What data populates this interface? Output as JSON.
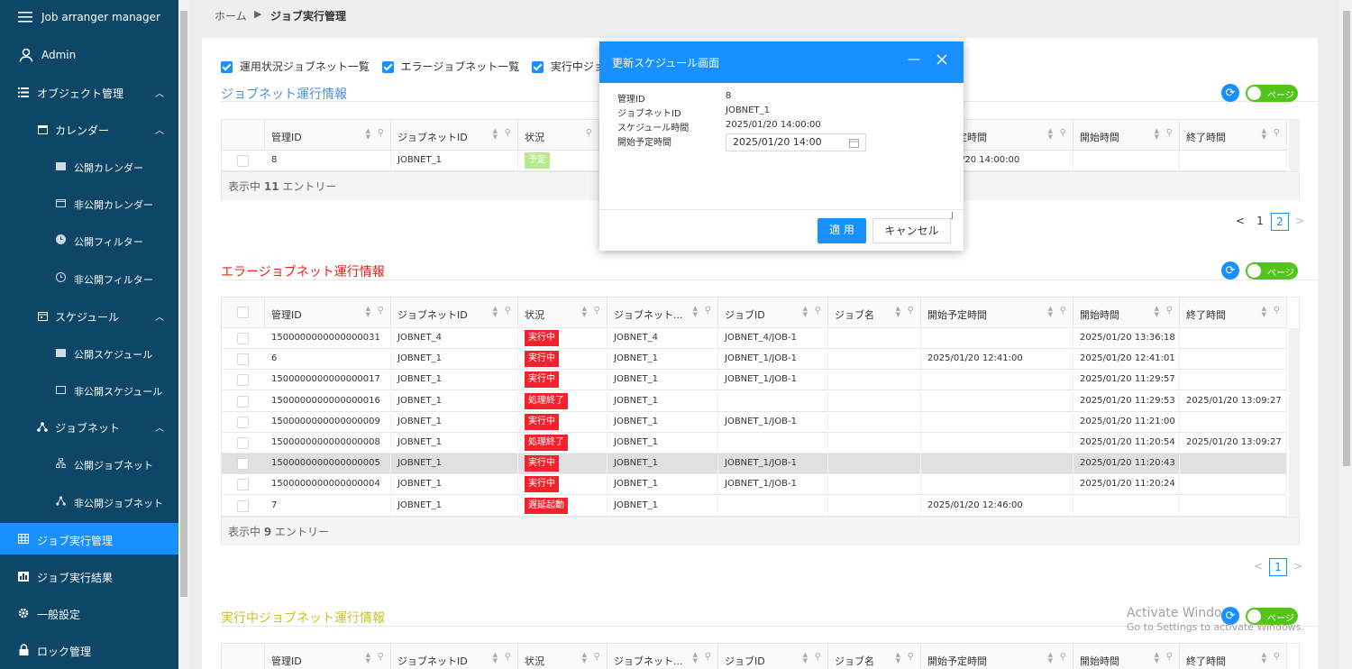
{
  "sidebar": {
    "app_title": "Job arranger manager",
    "user": "Admin",
    "items": [
      {
        "label": "オブジェクト管理",
        "chevron": "^"
      },
      {
        "label": "カレンダー",
        "chevron": "^"
      },
      {
        "label": "公開カレンダー"
      },
      {
        "label": "非公開カレンダー"
      },
      {
        "label": "公開フィルター"
      },
      {
        "label": "非公開フィルター"
      },
      {
        "label": "スケジュール",
        "chevron": "^"
      },
      {
        "label": "公開スケジュール"
      },
      {
        "label": "非公開スケジュール"
      },
      {
        "label": "ジョブネット",
        "chevron": "^"
      },
      {
        "label": "公開ジョブネット"
      },
      {
        "label": "非公開ジョブネット"
      },
      {
        "label": "ジョブ実行管理"
      },
      {
        "label": "ジョブ実行結果"
      },
      {
        "label": "一般設定"
      },
      {
        "label": "ロック管理"
      }
    ]
  },
  "breadcrumb": {
    "home": "ホーム",
    "sep": "▶",
    "current": "ジョブ実行管理"
  },
  "filters": [
    {
      "label": "運用状況ジョブネット一覧",
      "checked": true
    },
    {
      "label": "エラージョブネット一覧",
      "checked": true
    },
    {
      "label": "実行中ジョ",
      "checked": true
    }
  ],
  "colors": {
    "accent": "#1890ff",
    "sidebar": "#0d4667",
    "error": "#f5222d",
    "title_blue": "#4a90d9",
    "title_red": "#e0251b",
    "title_yellow": "#c5c22b"
  },
  "switch_label": "ページ",
  "section1": {
    "title": "ジョブネット運行情報",
    "headers": [
      "管理ID",
      "ジョブネットID",
      "状況",
      "定時間",
      "開始時間",
      "終了時間"
    ],
    "rows": [
      {
        "id": "8",
        "jobnet": "JOBNET_1",
        "status": "予定",
        "sched": "/20 14:00:00",
        "start": "",
        "end": ""
      }
    ],
    "footer_prefix": "表示中",
    "footer_count": "11",
    "footer_suffix": "エントリー",
    "pages": [
      "1",
      "2"
    ],
    "current_page": "2"
  },
  "section2": {
    "title": "エラージョブネット運行情報",
    "headers": [
      "管理ID",
      "ジョブネットID",
      "状況",
      "ジョブネット...",
      "ジョブID",
      "ジョブ名",
      "開始予定時間",
      "開始時間",
      "終了時間"
    ],
    "rows": [
      {
        "id": "1500000000000000031",
        "jobnet": "JOBNET_4",
        "status": "実行中",
        "jobnet2": "JOBNET_4",
        "jobid": "JOBNET_4/JOB-1",
        "jobname": "",
        "sched": "",
        "start": "2025/01/20 13:36:18",
        "end": ""
      },
      {
        "id": "6",
        "jobnet": "JOBNET_1",
        "status": "実行中",
        "jobnet2": "JOBNET_1",
        "jobid": "JOBNET_1/JOB-1",
        "jobname": "",
        "sched": "2025/01/20 12:41:00",
        "start": "2025/01/20 12:41:01",
        "end": ""
      },
      {
        "id": "1500000000000000017",
        "jobnet": "JOBNET_1",
        "status": "実行中",
        "jobnet2": "JOBNET_1",
        "jobid": "JOBNET_1/JOB-1",
        "jobname": "",
        "sched": "",
        "start": "2025/01/20 11:29:57",
        "end": ""
      },
      {
        "id": "1500000000000000016",
        "jobnet": "JOBNET_1",
        "status": "処理終了",
        "jobnet2": "JOBNET_1",
        "jobid": "",
        "jobname": "",
        "sched": "",
        "start": "2025/01/20 11:29:53",
        "end": "2025/01/20 13:09:27"
      },
      {
        "id": "1500000000000000009",
        "jobnet": "JOBNET_1",
        "status": "実行中",
        "jobnet2": "JOBNET_1",
        "jobid": "JOBNET_1/JOB-1",
        "jobname": "",
        "sched": "",
        "start": "2025/01/20 11:21:00",
        "end": ""
      },
      {
        "id": "1500000000000000008",
        "jobnet": "JOBNET_1",
        "status": "処理終了",
        "jobnet2": "JOBNET_1",
        "jobid": "",
        "jobname": "",
        "sched": "",
        "start": "2025/01/20 11:20:54",
        "end": "2025/01/20 13:09:27"
      },
      {
        "id": "1500000000000000005",
        "jobnet": "JOBNET_1",
        "status": "実行中",
        "jobnet2": "JOBNET_1",
        "jobid": "JOBNET_1/JOB-1",
        "jobname": "",
        "sched": "",
        "start": "2025/01/20 11:20:43",
        "end": "",
        "selected": true
      },
      {
        "id": "1500000000000000004",
        "jobnet": "JOBNET_1",
        "status": "実行中",
        "jobnet2": "JOBNET_1",
        "jobid": "JOBNET_1/JOB-1",
        "jobname": "",
        "sched": "",
        "start": "2025/01/20 11:20:24",
        "end": ""
      },
      {
        "id": "7",
        "jobnet": "JOBNET_1",
        "status": "遅延起動",
        "jobnet2": "JOBNET_1",
        "jobid": "",
        "jobname": "",
        "sched": "2025/01/20 12:46:00",
        "start": "",
        "end": ""
      }
    ],
    "footer_prefix": "表示中",
    "footer_count": "9",
    "footer_suffix": "エントリー",
    "pages": [
      "1"
    ],
    "current_page": "1"
  },
  "section3": {
    "title": "実行中ジョブネット運行情報",
    "headers": [
      "管理ID",
      "ジョブネットID",
      "状況",
      "ジョブネット...",
      "ジョブID",
      "ジョブ名",
      "開始予定時間",
      "開始時間",
      "終了時間"
    ]
  },
  "modal": {
    "title": "更新スケジュール画面",
    "fields": [
      {
        "label": "管理ID",
        "value": "8"
      },
      {
        "label": "ジョブネットID",
        "value": "JOBNET_1"
      },
      {
        "label": "スケジュール時間",
        "value": "2025/01/20 14:00:00"
      },
      {
        "label": "開始予定時間",
        "value": ""
      }
    ],
    "date_value": "2025/01/20 14:00",
    "apply_label": "適 用",
    "cancel_label": "キャンセル"
  },
  "watermark": {
    "line1": "Activate Windo",
    "line2": "Go to Settings to activate Windows."
  }
}
